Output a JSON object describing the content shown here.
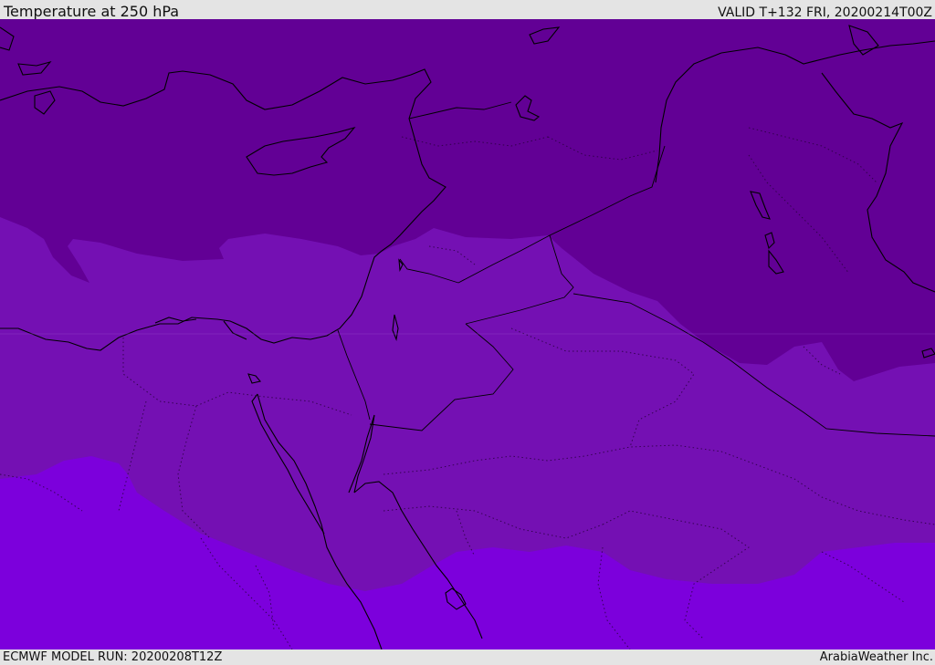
{
  "header": {
    "title": "Temperature at 250 hPa",
    "valid": "VALID T+132 FRI, 20200214T00Z"
  },
  "footer": {
    "model_run": "ECMWF MODEL RUN: 20200208T12Z",
    "credit": "ArabiaWeather Inc."
  },
  "map": {
    "region": "Eastern Mediterranean and Middle East",
    "colors": {
      "coldest_band": "#620095",
      "mid_band": "#7410b3",
      "warm_band": "#7c00dc",
      "coastline": "#000000",
      "border": "#000000"
    }
  }
}
